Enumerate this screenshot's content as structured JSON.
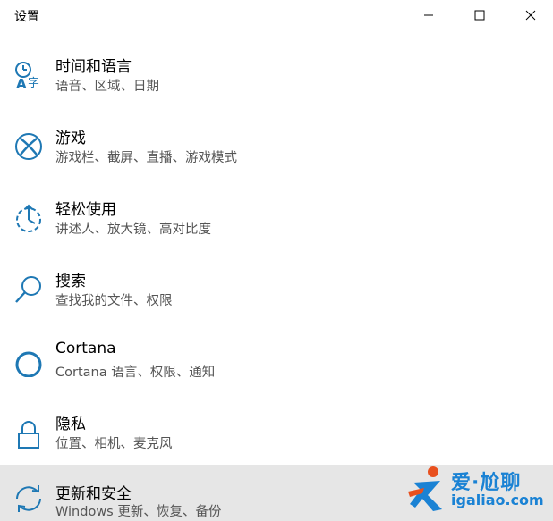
{
  "window": {
    "title": "设置"
  },
  "items": [
    {
      "title": "时间和语言",
      "description": "语音、区域、日期",
      "icon": "time-language-icon"
    },
    {
      "title": "游戏",
      "description": "游戏栏、截屏、直播、游戏模式",
      "icon": "xbox-icon"
    },
    {
      "title": "轻松使用",
      "description": "讲述人、放大镜、高对比度",
      "icon": "ease-of-access-icon"
    },
    {
      "title": "搜索",
      "description": "查找我的文件、权限",
      "icon": "search-icon"
    },
    {
      "title": "Cortana",
      "description": "Cortana 语言、权限、通知",
      "icon": "cortana-icon"
    },
    {
      "title": "隐私",
      "description": "位置、相机、麦克风",
      "icon": "lock-icon"
    },
    {
      "title": "更新和安全",
      "description": "Windows 更新、恢复、备份",
      "icon": "sync-icon",
      "selected": true
    }
  ],
  "watermark": {
    "brand": "爱·尬聊",
    "site": "igaliao.com"
  },
  "colors": {
    "accent": "#1e78b4",
    "selected_background": "#e6e6e6",
    "description_text": "#555555",
    "watermark": "#1a82d4"
  }
}
